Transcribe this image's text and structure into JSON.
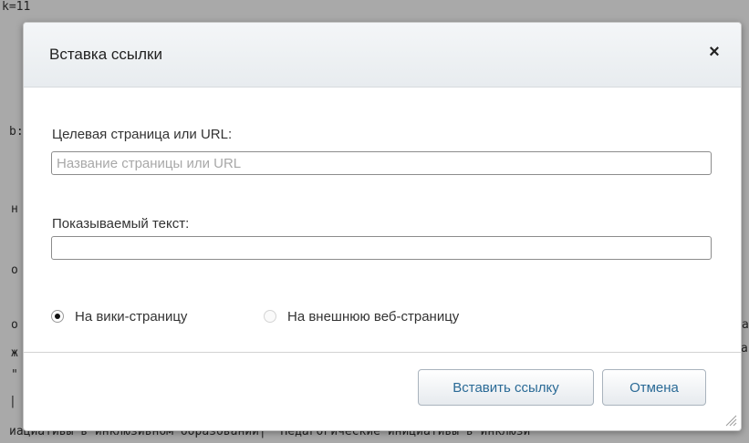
{
  "background": {
    "lines": [
      "k=11",
      "b:",
      "н",
      "о",
      "о",
      "ж",
      "\"",
      "|",
      "иациативы в инклюзивном образовании| \"Педагогические инициативы в инклюзи"
    ],
    "right_fragments": [
      "а",
      "а\""
    ]
  },
  "dialog": {
    "title": "Вставка ссылки",
    "close_label": "×",
    "url_label": "Целевая страница или URL:",
    "url_value": "",
    "url_placeholder": "Название страницы или URL",
    "text_label": "Показываемый текст:",
    "text_value": "",
    "radio_wiki_label": "На вики-страницу",
    "radio_wiki_checked": true,
    "radio_external_label": "На внешнюю веб-страницу",
    "radio_external_checked": false,
    "insert_button": "Вставить ссылку",
    "cancel_button": "Отмена"
  },
  "colors": {
    "overlay": "#a9a9a9",
    "button_text": "#2a6a96"
  }
}
